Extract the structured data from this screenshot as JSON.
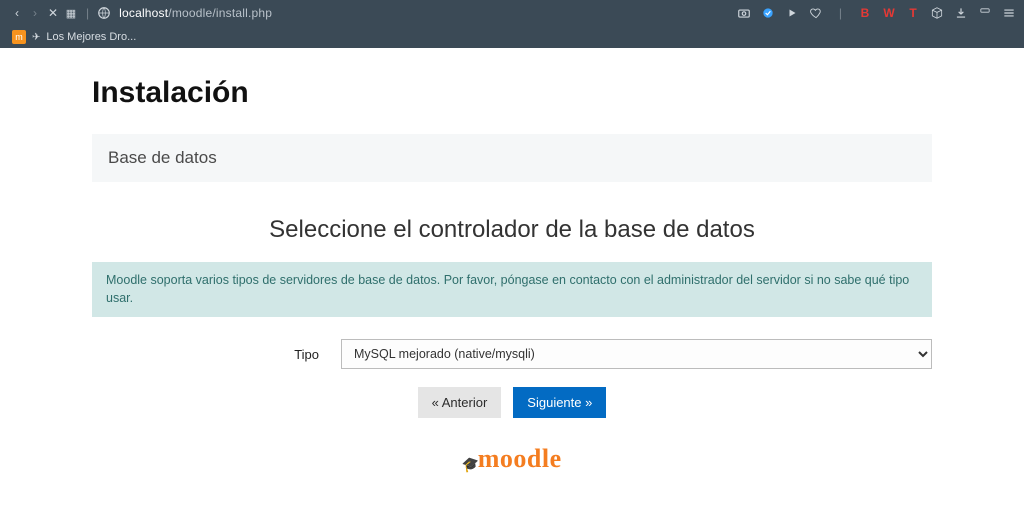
{
  "browser": {
    "url_host": "localhost",
    "url_path": "/moodle/install.php",
    "tab_title": "Los Mejores Dro...",
    "red_icons": [
      "B",
      "W",
      "T"
    ]
  },
  "page": {
    "title": "Instalación",
    "card_header": "Base de datos",
    "subheading": "Seleccione el controlador de la base de datos",
    "alert_text": "Moodle soporta varios tipos de servidores de base de datos. Por favor, póngase en contacto con el administrador del servidor si no sabe qué tipo usar.",
    "form": {
      "label": "Tipo",
      "selected": "MySQL mejorado (native/mysqli)"
    },
    "buttons": {
      "prev": "« Anterior",
      "next": "Siguiente »"
    },
    "brand": "moodle"
  }
}
